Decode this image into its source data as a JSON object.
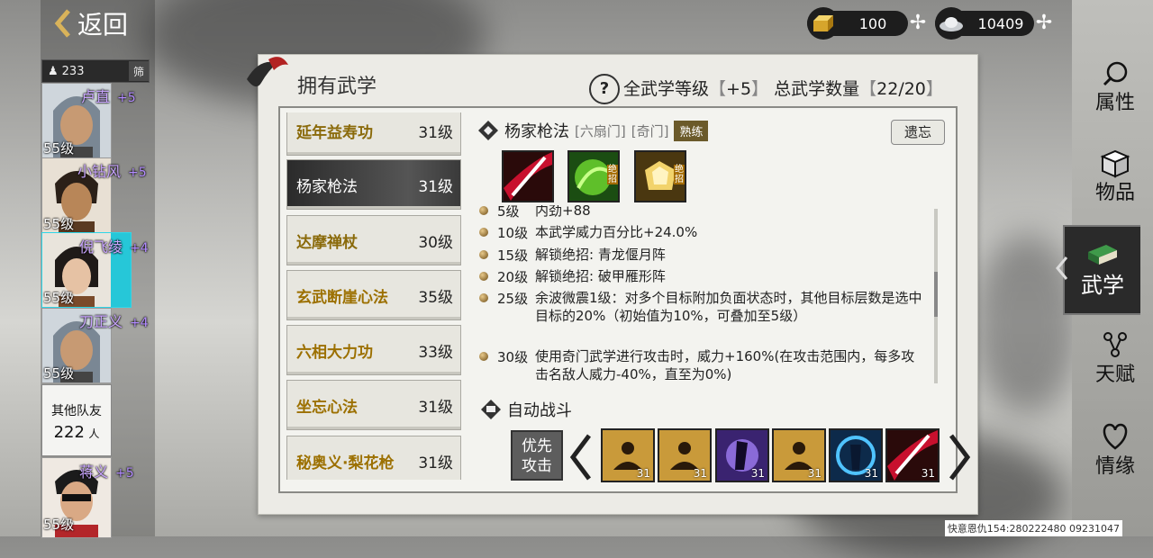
{
  "nav": {
    "back_label": "返回"
  },
  "roster": {
    "count": "233",
    "filter_label": "筛",
    "heroes": [
      {
        "name": "卢直",
        "bonus": "+5",
        "level": "55级"
      },
      {
        "name": "小钻风",
        "bonus": "+5",
        "level": "55级"
      },
      {
        "name": "倪飞绫",
        "bonus": "+4",
        "level": "55级"
      },
      {
        "name": "刀正义",
        "bonus": "+4",
        "level": "55级"
      },
      {
        "name": "蒋义",
        "bonus": "+5",
        "level": "55级"
      }
    ],
    "teammates": {
      "label": "其他队友",
      "count": "222",
      "unit": "人"
    }
  },
  "currency": [
    {
      "icon": "gold-ingot-icon",
      "value": "100"
    },
    {
      "icon": "silver-ingot-icon",
      "value": "10409"
    }
  ],
  "panel": {
    "title": "拥有武学",
    "help_glyph": "?",
    "all_level_label": "全武学等级",
    "all_level_value": "+5",
    "total_label": "总武学数量",
    "total_value": "22/20"
  },
  "skills": [
    {
      "name": "延年益寿功",
      "level": "31级"
    },
    {
      "name": "杨家枪法",
      "level": "31级",
      "active": true
    },
    {
      "name": "达摩禅杖",
      "level": "30级"
    },
    {
      "name": "玄武断崖心法",
      "level": "35级"
    },
    {
      "name": "六相大力功",
      "level": "33级"
    },
    {
      "name": "坐忘心法",
      "level": "31级"
    },
    {
      "name": "秘奥义·梨花枪",
      "level": "31级"
    }
  ],
  "detail": {
    "name": "杨家枪法",
    "sect1": "[六扇门]",
    "sect2": "[奇门]",
    "rank": "熟练",
    "forget_label": "遗忘",
    "art_tag": "绝招",
    "effects": [
      {
        "level": "5级",
        "text": "内劲+88"
      },
      {
        "level": "10级",
        "text": "本武学威力百分比+24.0%"
      },
      {
        "level": "15级",
        "text": "解锁绝招:  青龙偃月阵"
      },
      {
        "level": "20级",
        "text": "解锁绝招:  破甲雁形阵"
      },
      {
        "level": "25级",
        "text": "余波微震1级：对多个目标附加负面状态时，其他目标层数是选中目标的20%（初始值为10%，可叠加至5级）"
      },
      {
        "level": "30级",
        "text": "使用奇门武学进行攻击时，威力+160%(在攻击范围内，每多攻击名敌人威力-40%，直至为0%)"
      }
    ]
  },
  "auto_battle": {
    "title": "自动战斗",
    "priority_label": "优先攻击",
    "slots": [
      "31",
      "31",
      "31",
      "31",
      "31",
      "31"
    ]
  },
  "tabs": [
    {
      "label": "属性",
      "icon": "attribute-icon"
    },
    {
      "label": "物品",
      "icon": "item-box-icon"
    },
    {
      "label": "武学",
      "icon": "martial-book-icon",
      "active": true
    },
    {
      "label": "天赋",
      "icon": "talent-icon"
    },
    {
      "label": "情缘",
      "icon": "heart-bond-icon"
    }
  ],
  "watermark": "快意恩仇154:280222480 09231047"
}
